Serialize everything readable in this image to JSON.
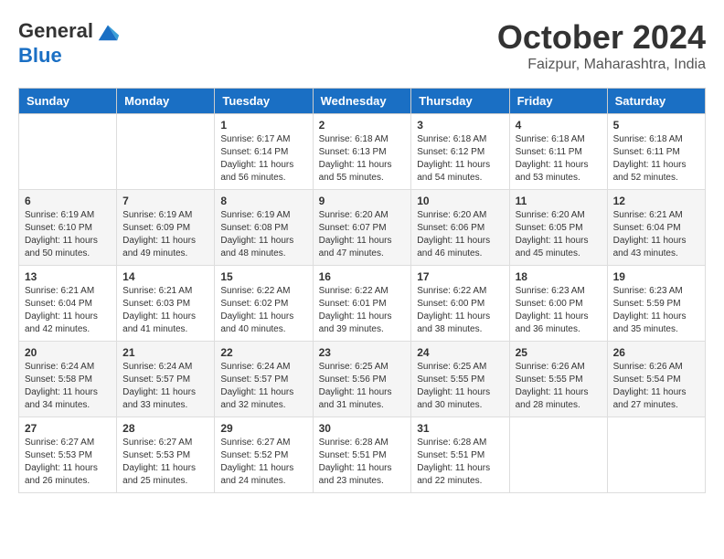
{
  "logo": {
    "general": "General",
    "blue": "Blue"
  },
  "header": {
    "month_year": "October 2024",
    "location": "Faizpur, Maharashtra, India"
  },
  "days_of_week": [
    "Sunday",
    "Monday",
    "Tuesday",
    "Wednesday",
    "Thursday",
    "Friday",
    "Saturday"
  ],
  "weeks": [
    [
      {
        "day": null
      },
      {
        "day": null
      },
      {
        "day": 1,
        "sunrise": "6:17 AM",
        "sunset": "6:14 PM",
        "daylight": "11 hours and 56 minutes."
      },
      {
        "day": 2,
        "sunrise": "6:18 AM",
        "sunset": "6:13 PM",
        "daylight": "11 hours and 55 minutes."
      },
      {
        "day": 3,
        "sunrise": "6:18 AM",
        "sunset": "6:12 PM",
        "daylight": "11 hours and 54 minutes."
      },
      {
        "day": 4,
        "sunrise": "6:18 AM",
        "sunset": "6:11 PM",
        "daylight": "11 hours and 53 minutes."
      },
      {
        "day": 5,
        "sunrise": "6:18 AM",
        "sunset": "6:11 PM",
        "daylight": "11 hours and 52 minutes."
      }
    ],
    [
      {
        "day": 6,
        "sunrise": "6:19 AM",
        "sunset": "6:10 PM",
        "daylight": "11 hours and 50 minutes."
      },
      {
        "day": 7,
        "sunrise": "6:19 AM",
        "sunset": "6:09 PM",
        "daylight": "11 hours and 49 minutes."
      },
      {
        "day": 8,
        "sunrise": "6:19 AM",
        "sunset": "6:08 PM",
        "daylight": "11 hours and 48 minutes."
      },
      {
        "day": 9,
        "sunrise": "6:20 AM",
        "sunset": "6:07 PM",
        "daylight": "11 hours and 47 minutes."
      },
      {
        "day": 10,
        "sunrise": "6:20 AM",
        "sunset": "6:06 PM",
        "daylight": "11 hours and 46 minutes."
      },
      {
        "day": 11,
        "sunrise": "6:20 AM",
        "sunset": "6:05 PM",
        "daylight": "11 hours and 45 minutes."
      },
      {
        "day": 12,
        "sunrise": "6:21 AM",
        "sunset": "6:04 PM",
        "daylight": "11 hours and 43 minutes."
      }
    ],
    [
      {
        "day": 13,
        "sunrise": "6:21 AM",
        "sunset": "6:04 PM",
        "daylight": "11 hours and 42 minutes."
      },
      {
        "day": 14,
        "sunrise": "6:21 AM",
        "sunset": "6:03 PM",
        "daylight": "11 hours and 41 minutes."
      },
      {
        "day": 15,
        "sunrise": "6:22 AM",
        "sunset": "6:02 PM",
        "daylight": "11 hours and 40 minutes."
      },
      {
        "day": 16,
        "sunrise": "6:22 AM",
        "sunset": "6:01 PM",
        "daylight": "11 hours and 39 minutes."
      },
      {
        "day": 17,
        "sunrise": "6:22 AM",
        "sunset": "6:00 PM",
        "daylight": "11 hours and 38 minutes."
      },
      {
        "day": 18,
        "sunrise": "6:23 AM",
        "sunset": "6:00 PM",
        "daylight": "11 hours and 36 minutes."
      },
      {
        "day": 19,
        "sunrise": "6:23 AM",
        "sunset": "5:59 PM",
        "daylight": "11 hours and 35 minutes."
      }
    ],
    [
      {
        "day": 20,
        "sunrise": "6:24 AM",
        "sunset": "5:58 PM",
        "daylight": "11 hours and 34 minutes."
      },
      {
        "day": 21,
        "sunrise": "6:24 AM",
        "sunset": "5:57 PM",
        "daylight": "11 hours and 33 minutes."
      },
      {
        "day": 22,
        "sunrise": "6:24 AM",
        "sunset": "5:57 PM",
        "daylight": "11 hours and 32 minutes."
      },
      {
        "day": 23,
        "sunrise": "6:25 AM",
        "sunset": "5:56 PM",
        "daylight": "11 hours and 31 minutes."
      },
      {
        "day": 24,
        "sunrise": "6:25 AM",
        "sunset": "5:55 PM",
        "daylight": "11 hours and 30 minutes."
      },
      {
        "day": 25,
        "sunrise": "6:26 AM",
        "sunset": "5:55 PM",
        "daylight": "11 hours and 28 minutes."
      },
      {
        "day": 26,
        "sunrise": "6:26 AM",
        "sunset": "5:54 PM",
        "daylight": "11 hours and 27 minutes."
      }
    ],
    [
      {
        "day": 27,
        "sunrise": "6:27 AM",
        "sunset": "5:53 PM",
        "daylight": "11 hours and 26 minutes."
      },
      {
        "day": 28,
        "sunrise": "6:27 AM",
        "sunset": "5:53 PM",
        "daylight": "11 hours and 25 minutes."
      },
      {
        "day": 29,
        "sunrise": "6:27 AM",
        "sunset": "5:52 PM",
        "daylight": "11 hours and 24 minutes."
      },
      {
        "day": 30,
        "sunrise": "6:28 AM",
        "sunset": "5:51 PM",
        "daylight": "11 hours and 23 minutes."
      },
      {
        "day": 31,
        "sunrise": "6:28 AM",
        "sunset": "5:51 PM",
        "daylight": "11 hours and 22 minutes."
      },
      {
        "day": null
      },
      {
        "day": null
      }
    ]
  ],
  "labels": {
    "sunrise_prefix": "Sunrise: ",
    "sunset_prefix": "Sunset: ",
    "daylight_prefix": "Daylight: "
  }
}
